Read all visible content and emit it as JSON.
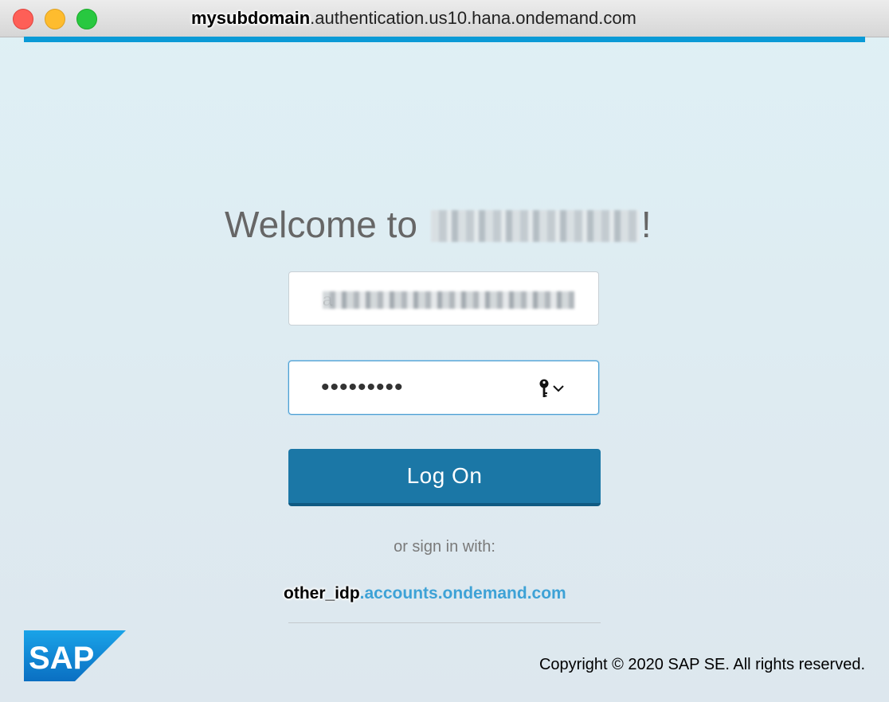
{
  "window": {
    "title_prefix": "mysubdomain",
    "title_host": ".authentication.us10.hana.ondemand.com",
    "accent_color": "#0a9ad6"
  },
  "login": {
    "welcome_text": "Welcome to",
    "welcome_suffix": "!",
    "email_visible_char": "a",
    "password_value": "•••••••••",
    "login_button_label": "Log On",
    "login_button_color": "#1b77a6",
    "or_sign_in_label": "or sign in with:",
    "idp_prefix": "other_idp",
    "idp_host": ".accounts.ondemand.com",
    "link_color": "#3ea2d6"
  },
  "footer": {
    "logo_text": "SAP",
    "copyright": "Copyright © 2020 SAP SE. All rights reserved."
  },
  "icons": {
    "password_manager": "key-icon",
    "dropdown": "chevron-down-icon"
  }
}
